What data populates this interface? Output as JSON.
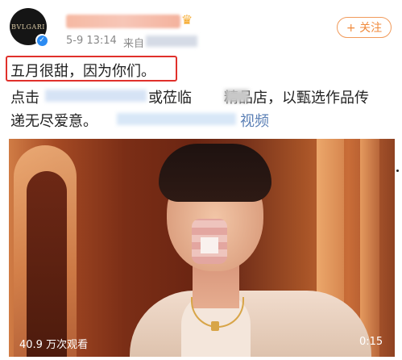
{
  "header": {
    "avatar_text": "BVLGARI",
    "verified_icon": "verified-check-icon",
    "badge_icon": "vip-crown-icon",
    "time": "5-9 13:14",
    "from_label": "来自",
    "follow_label": "+ 关注"
  },
  "post": {
    "highlight_line": "五月很甜，因为你们。",
    "line2_start": "点击",
    "line2_mid": "或莅临",
    "line2_end": "精品店，以甄选作品传",
    "line3_start": "递无尽爱意。",
    "video_link_label": "视频"
  },
  "video": {
    "views": "40.9 万次观看",
    "duration": "0:15"
  },
  "colors": {
    "accent_orange": "#f08a3c",
    "highlight_red": "#e0302b",
    "link_blue": "#5a7fb5"
  }
}
